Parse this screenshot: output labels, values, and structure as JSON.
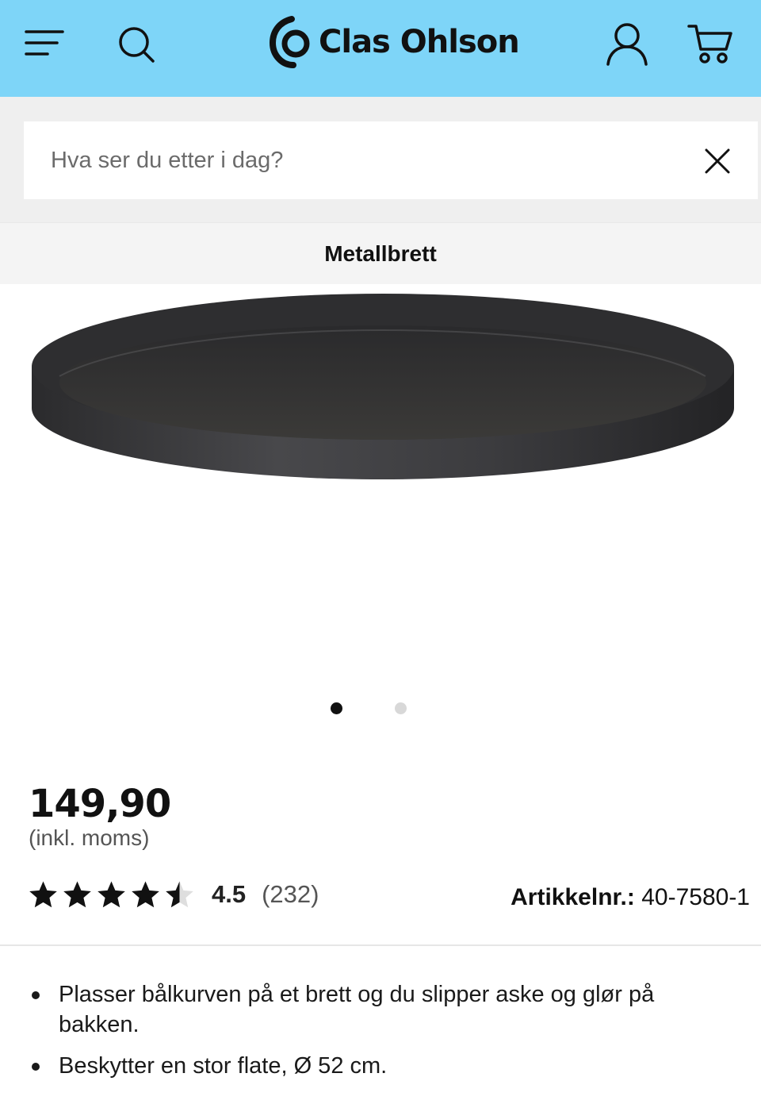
{
  "header": {
    "brand_name": "Clas Ohlson",
    "icons": {
      "menu": "hamburger-menu-icon",
      "search": "search-icon",
      "logo": "clas-ohlson-logo",
      "account": "account-icon",
      "cart": "cart-icon"
    },
    "background_color": "#7ed5f8"
  },
  "search": {
    "placeholder": "Hva ser du etter i dag?",
    "value": "",
    "clear_icon": "close-icon"
  },
  "product": {
    "title": "Metallbrett",
    "image_carousel": {
      "total_slides": 2,
      "active_index": 0
    },
    "price": "149,90",
    "vat_note": "(inkl. moms)",
    "rating": {
      "value": 4.5,
      "display": "4.5",
      "count_display": "(232)",
      "max_stars": 5
    },
    "article_label": "Artikkelnr.:",
    "article_number": "40-7580-1",
    "features": [
      "Plasser bålkurven på et brett og du slipper aske og glør på bakken.",
      "Beskytter en stor flate, Ø 52 cm."
    ]
  }
}
